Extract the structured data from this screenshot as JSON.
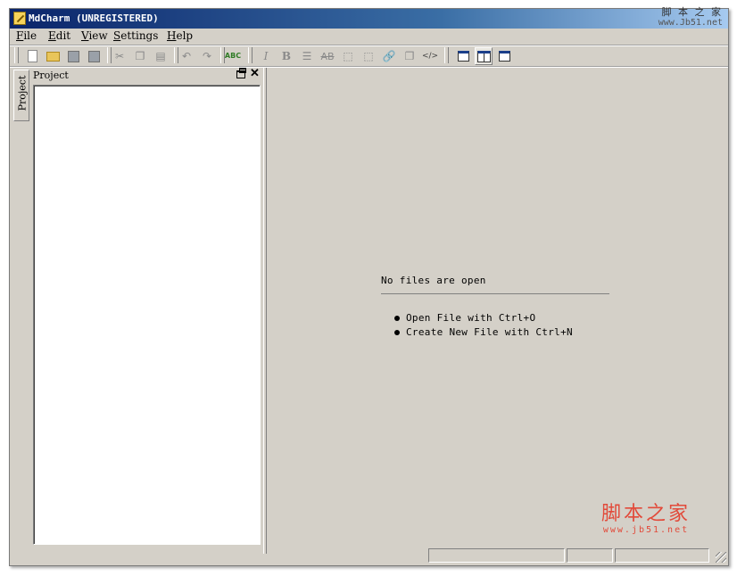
{
  "window": {
    "title": "MdCharm (UNREGISTERED)"
  },
  "watermark_top": {
    "text": "脚 本 之 家",
    "url": "www.Jb51.net"
  },
  "menubar": {
    "items": [
      "File",
      "Edit",
      "View",
      "Settings",
      "Help"
    ]
  },
  "toolbar": {
    "buttons": [
      {
        "icon": "new-file-icon"
      },
      {
        "icon": "open-file-icon"
      },
      {
        "icon": "save-icon"
      },
      {
        "icon": "save-all-icon"
      },
      {
        "icon": "cut-icon"
      },
      {
        "icon": "copy-icon"
      },
      {
        "icon": "paste-icon"
      },
      {
        "icon": "undo-icon"
      },
      {
        "icon": "redo-icon"
      },
      {
        "icon": "spellcheck-icon",
        "label": "ABC"
      },
      {
        "icon": "italic-icon",
        "label": "I"
      },
      {
        "icon": "bold-icon",
        "label": "B"
      },
      {
        "icon": "ordered-list-icon"
      },
      {
        "icon": "strikethrough-icon",
        "label": "AB"
      },
      {
        "icon": "horizontal-rule-icon"
      },
      {
        "icon": "table-icon"
      },
      {
        "icon": "link-icon"
      },
      {
        "icon": "image-icon"
      },
      {
        "icon": "code-icon",
        "label": "</>"
      },
      {
        "icon": "editor-only-view-icon"
      },
      {
        "icon": "split-view-icon"
      },
      {
        "icon": "preview-only-view-icon"
      }
    ]
  },
  "sidebar": {
    "tab_label": "Project"
  },
  "project_panel": {
    "title": "Project"
  },
  "editor": {
    "empty_title": "No files are open",
    "hints": [
      "Open File with Ctrl+O",
      "Create New File with Ctrl+N"
    ]
  },
  "watermark_bottom": {
    "text": "脚本之家",
    "url": "www.jb51.net"
  },
  "colors": {
    "titlebar_start": "#0a246a",
    "titlebar_end": "#a6caf0",
    "chrome": "#d4d0c8",
    "watermark": "#e24a3a"
  }
}
